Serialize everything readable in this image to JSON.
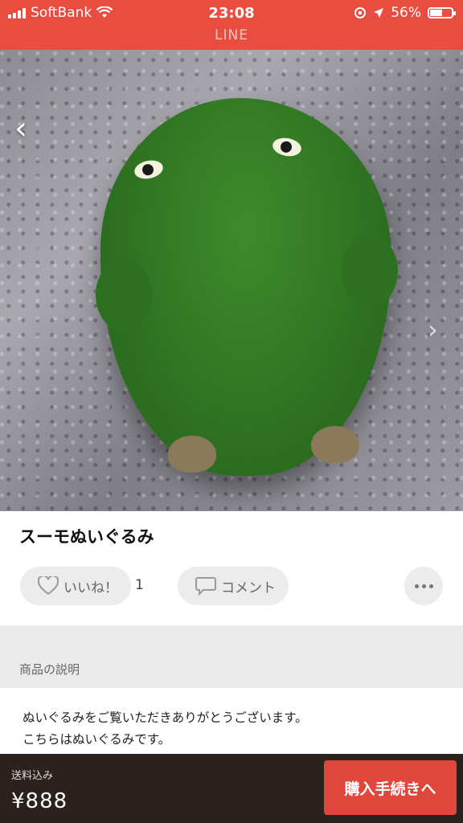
{
  "status_bar": {
    "carrier": "SoftBank",
    "time": "23:08",
    "battery_percent": "56%",
    "battery_level": 0.56,
    "app_name": "LINE",
    "color": "#e94d3f"
  },
  "photo": {
    "image_count_dots": 1,
    "back_icon": "chevron-left-icon",
    "next_icon": "chevron-right-icon"
  },
  "item": {
    "title": "スーモぬいぐるみ",
    "like_label": "いいね！",
    "like_count": "1",
    "comment_label": "コメント"
  },
  "description": {
    "section_label": "商品の説明",
    "lines": [
      "ぬいぐるみをご覧いただきありがとうございます。",
      "こちらはぬいぐるみです。"
    ]
  },
  "bottom_bar": {
    "shipping_label": "送料込み",
    "price": "¥888",
    "buy_button_label": "購入手続きへ",
    "buy_color": "#e0473c"
  }
}
